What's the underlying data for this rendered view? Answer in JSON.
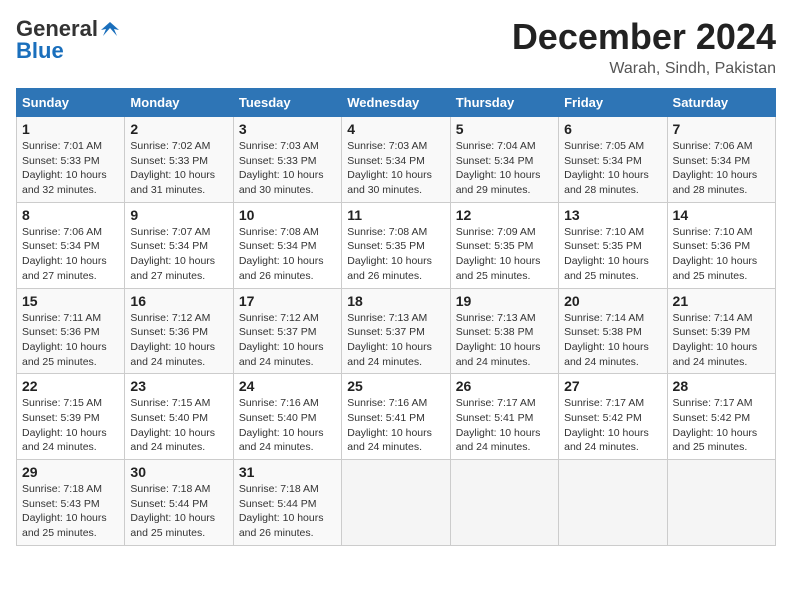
{
  "header": {
    "logo_general": "General",
    "logo_blue": "Blue",
    "month": "December 2024",
    "location": "Warah, Sindh, Pakistan"
  },
  "days_of_week": [
    "Sunday",
    "Monday",
    "Tuesday",
    "Wednesday",
    "Thursday",
    "Friday",
    "Saturday"
  ],
  "weeks": [
    [
      {
        "day": "1",
        "sunrise": "7:01 AM",
        "sunset": "5:33 PM",
        "daylight": "10 hours and 32 minutes."
      },
      {
        "day": "2",
        "sunrise": "7:02 AM",
        "sunset": "5:33 PM",
        "daylight": "10 hours and 31 minutes."
      },
      {
        "day": "3",
        "sunrise": "7:03 AM",
        "sunset": "5:33 PM",
        "daylight": "10 hours and 30 minutes."
      },
      {
        "day": "4",
        "sunrise": "7:03 AM",
        "sunset": "5:34 PM",
        "daylight": "10 hours and 30 minutes."
      },
      {
        "day": "5",
        "sunrise": "7:04 AM",
        "sunset": "5:34 PM",
        "daylight": "10 hours and 29 minutes."
      },
      {
        "day": "6",
        "sunrise": "7:05 AM",
        "sunset": "5:34 PM",
        "daylight": "10 hours and 28 minutes."
      },
      {
        "day": "7",
        "sunrise": "7:06 AM",
        "sunset": "5:34 PM",
        "daylight": "10 hours and 28 minutes."
      }
    ],
    [
      {
        "day": "8",
        "sunrise": "7:06 AM",
        "sunset": "5:34 PM",
        "daylight": "10 hours and 27 minutes."
      },
      {
        "day": "9",
        "sunrise": "7:07 AM",
        "sunset": "5:34 PM",
        "daylight": "10 hours and 27 minutes."
      },
      {
        "day": "10",
        "sunrise": "7:08 AM",
        "sunset": "5:34 PM",
        "daylight": "10 hours and 26 minutes."
      },
      {
        "day": "11",
        "sunrise": "7:08 AM",
        "sunset": "5:35 PM",
        "daylight": "10 hours and 26 minutes."
      },
      {
        "day": "12",
        "sunrise": "7:09 AM",
        "sunset": "5:35 PM",
        "daylight": "10 hours and 25 minutes."
      },
      {
        "day": "13",
        "sunrise": "7:10 AM",
        "sunset": "5:35 PM",
        "daylight": "10 hours and 25 minutes."
      },
      {
        "day": "14",
        "sunrise": "7:10 AM",
        "sunset": "5:36 PM",
        "daylight": "10 hours and 25 minutes."
      }
    ],
    [
      {
        "day": "15",
        "sunrise": "7:11 AM",
        "sunset": "5:36 PM",
        "daylight": "10 hours and 25 minutes."
      },
      {
        "day": "16",
        "sunrise": "7:12 AM",
        "sunset": "5:36 PM",
        "daylight": "10 hours and 24 minutes."
      },
      {
        "day": "17",
        "sunrise": "7:12 AM",
        "sunset": "5:37 PM",
        "daylight": "10 hours and 24 minutes."
      },
      {
        "day": "18",
        "sunrise": "7:13 AM",
        "sunset": "5:37 PM",
        "daylight": "10 hours and 24 minutes."
      },
      {
        "day": "19",
        "sunrise": "7:13 AM",
        "sunset": "5:38 PM",
        "daylight": "10 hours and 24 minutes."
      },
      {
        "day": "20",
        "sunrise": "7:14 AM",
        "sunset": "5:38 PM",
        "daylight": "10 hours and 24 minutes."
      },
      {
        "day": "21",
        "sunrise": "7:14 AM",
        "sunset": "5:39 PM",
        "daylight": "10 hours and 24 minutes."
      }
    ],
    [
      {
        "day": "22",
        "sunrise": "7:15 AM",
        "sunset": "5:39 PM",
        "daylight": "10 hours and 24 minutes."
      },
      {
        "day": "23",
        "sunrise": "7:15 AM",
        "sunset": "5:40 PM",
        "daylight": "10 hours and 24 minutes."
      },
      {
        "day": "24",
        "sunrise": "7:16 AM",
        "sunset": "5:40 PM",
        "daylight": "10 hours and 24 minutes."
      },
      {
        "day": "25",
        "sunrise": "7:16 AM",
        "sunset": "5:41 PM",
        "daylight": "10 hours and 24 minutes."
      },
      {
        "day": "26",
        "sunrise": "7:17 AM",
        "sunset": "5:41 PM",
        "daylight": "10 hours and 24 minutes."
      },
      {
        "day": "27",
        "sunrise": "7:17 AM",
        "sunset": "5:42 PM",
        "daylight": "10 hours and 24 minutes."
      },
      {
        "day": "28",
        "sunrise": "7:17 AM",
        "sunset": "5:42 PM",
        "daylight": "10 hours and 25 minutes."
      }
    ],
    [
      {
        "day": "29",
        "sunrise": "7:18 AM",
        "sunset": "5:43 PM",
        "daylight": "10 hours and 25 minutes."
      },
      {
        "day": "30",
        "sunrise": "7:18 AM",
        "sunset": "5:44 PM",
        "daylight": "10 hours and 25 minutes."
      },
      {
        "day": "31",
        "sunrise": "7:18 AM",
        "sunset": "5:44 PM",
        "daylight": "10 hours and 26 minutes."
      },
      null,
      null,
      null,
      null
    ]
  ],
  "labels": {
    "sunrise": "Sunrise:",
    "sunset": "Sunset:",
    "daylight": "Daylight:"
  }
}
